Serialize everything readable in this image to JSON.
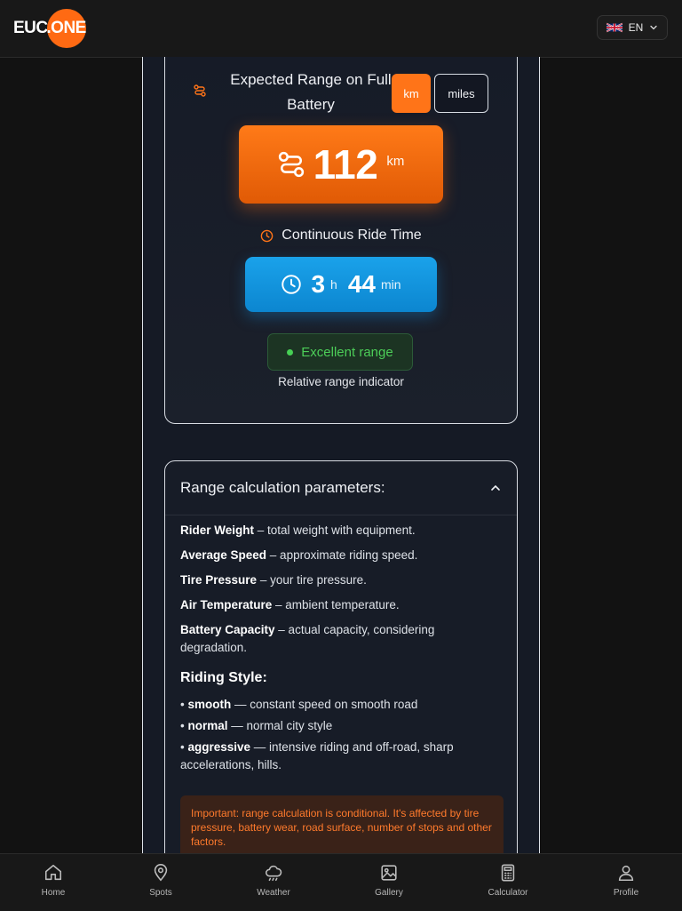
{
  "app": {
    "logo_left": "EUC",
    "logo_right": ".ONE",
    "language": "EN"
  },
  "result": {
    "range_title": "Expected Range on Full Battery",
    "unit_km": "km",
    "unit_miles": "miles",
    "range_value": "112",
    "range_unit": "km",
    "time_title": "Continuous Ride Time",
    "time_hours": "3",
    "time_hours_unit": "h",
    "time_minutes": "44",
    "time_minutes_unit": "min",
    "badge": "Excellent range",
    "badge_note": "Relative range indicator"
  },
  "params": {
    "title": "Range calculation parameters:",
    "items": [
      {
        "term": "Rider Weight",
        "desc": " – total weight with equipment."
      },
      {
        "term": "Average Speed",
        "desc": " – approximate riding speed."
      },
      {
        "term": "Tire Pressure",
        "desc": " – your tire pressure."
      },
      {
        "term": "Air Temperature",
        "desc": " – ambient temperature."
      },
      {
        "term": "Battery Capacity",
        "desc": " – actual capacity, considering degradation."
      }
    ],
    "style_title": "Riding Style:",
    "styles": [
      {
        "bullet": "•",
        "term": "smooth",
        "desc": " — constant speed on smooth road"
      },
      {
        "bullet": "•",
        "term": "normal",
        "desc": " — normal city style"
      },
      {
        "bullet": "•",
        "term": "aggressive",
        "desc": " — intensive riding and off-road, sharp accelerations, hills."
      }
    ],
    "warning": "Important: range calculation is conditional. It's affected by tire pressure, battery wear, road surface, number of stops and other factors."
  },
  "nav": {
    "home": "Home",
    "spots": "Spots",
    "weather": "Weather",
    "gallery": "Gallery",
    "calculator": "Calculator",
    "profile": "Profile"
  },
  "colors": {
    "accent_orange": "#ff7418",
    "accent_blue": "#1aa2ea",
    "success_green": "#4ccd58",
    "warning_text": "#ff7a2c"
  },
  "icons": [
    "uk-flag-icon",
    "chevron-down-icon",
    "route-icon",
    "clock-icon",
    "chevron-up-icon",
    "home-icon",
    "map-pin-icon",
    "cloud-icon",
    "image-icon",
    "calculator-icon",
    "user-icon"
  ]
}
